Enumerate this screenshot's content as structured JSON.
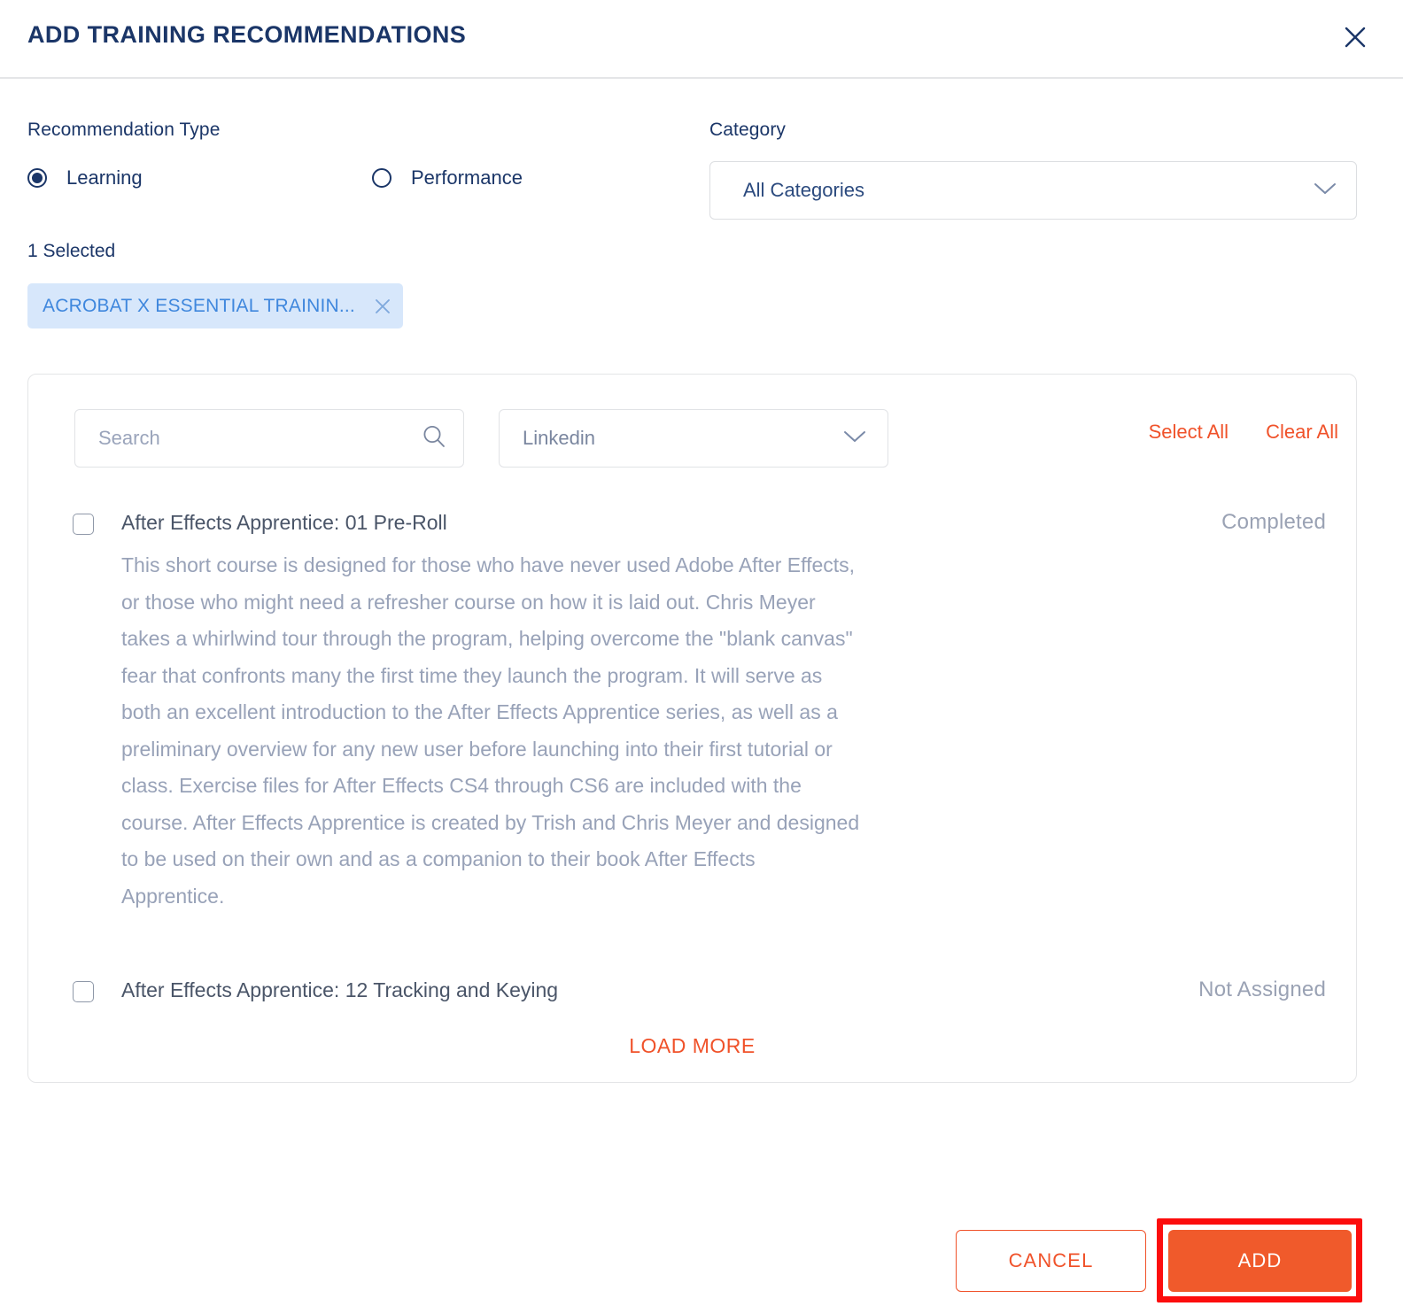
{
  "header": {
    "title": "ADD TRAINING RECOMMENDATIONS",
    "close_icon": "close-icon"
  },
  "form": {
    "recommendation_type_label": "Recommendation Type",
    "options": [
      {
        "label": "Learning",
        "selected": true
      },
      {
        "label": "Performance",
        "selected": false
      }
    ],
    "category_label": "Category",
    "category_value": "All Categories",
    "category_chevron_icon": "chevron-down-icon"
  },
  "selection": {
    "count_text": "1 Selected",
    "chips": [
      {
        "label": "ACROBAT X ESSENTIAL TRAININ...",
        "remove_icon": "close-icon"
      }
    ]
  },
  "panel": {
    "search": {
      "placeholder": "Search",
      "value": "",
      "icon": "search-icon"
    },
    "source": {
      "value": "Linkedin",
      "chevron_icon": "chevron-down-icon"
    },
    "select_all_label": "Select All",
    "clear_all_label": "Clear All",
    "courses": [
      {
        "title": "After Effects Apprentice: 01 Pre-Roll",
        "status": "Completed",
        "checked": false,
        "description": "This short course is designed for those who have never used Adobe After Effects, or those who might need a refresher course on how it is laid out. Chris Meyer takes a whirlwind tour through the program, helping overcome the \"blank canvas\" fear that confronts many the first time they launch the program. It will serve as both an excellent introduction to the After Effects Apprentice series, as well as a preliminary overview for any new user before launching into their first tutorial or class. Exercise files for After Effects CS4 through CS6 are included with the course. After Effects Apprentice is created by Trish and Chris Meyer and designed to be used on their own and as a companion to their book After Effects Apprentice."
      },
      {
        "title": "After Effects Apprentice: 12 Tracking and Keying",
        "status": "Not Assigned",
        "checked": false,
        "description": ""
      }
    ],
    "load_more_label": "LOAD MORE"
  },
  "footer": {
    "cancel_label": "CANCEL",
    "add_label": "ADD"
  },
  "colors": {
    "title_navy": "#1b3668",
    "accent_orange": "#f05a2b",
    "chip_bg": "#d7e7fb",
    "chip_text": "#3f87dd",
    "highlight_red": "#fc0d0d"
  }
}
